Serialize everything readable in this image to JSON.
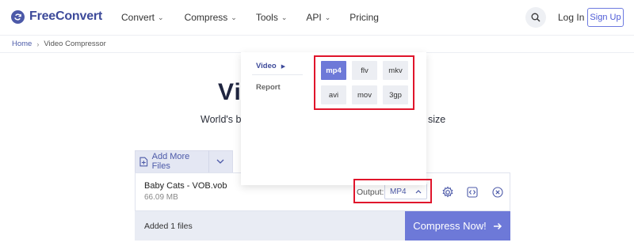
{
  "header": {
    "logo_text": "FreeConvert",
    "nav": [
      {
        "label": "Convert"
      },
      {
        "label": "Compress"
      },
      {
        "label": "Tools"
      },
      {
        "label": "API"
      },
      {
        "label": "Pricing"
      }
    ],
    "login_label": "Log In",
    "signup_label": "Sign Up"
  },
  "breadcrumb": {
    "home": "Home",
    "current": "Video Compressor"
  },
  "hero": {
    "title_visible": "Vi",
    "subtitle_left": "World's be",
    "subtitle_right": "size"
  },
  "upload": {
    "add_files_label": "Add More Files",
    "file": {
      "name": "Baby Cats - VOB.vob",
      "size": "66.09 MB",
      "output_label": "Output:",
      "output_value": "MP4"
    },
    "added_text": "Added 1 files",
    "compress_label": "Compress Now!"
  },
  "dropdown": {
    "categories": [
      {
        "label": "Video",
        "active": true
      },
      {
        "label": "Report",
        "active": false
      }
    ],
    "formats": [
      {
        "label": "mp4",
        "active": true
      },
      {
        "label": "flv",
        "active": false
      },
      {
        "label": "mkv",
        "active": false
      },
      {
        "label": "avi",
        "active": false
      },
      {
        "label": "mov",
        "active": false
      },
      {
        "label": "3gp",
        "active": false
      }
    ]
  },
  "colors": {
    "accent": "#6d79d8",
    "brand": "#3d4a9a",
    "highlight": "#e0152b"
  }
}
